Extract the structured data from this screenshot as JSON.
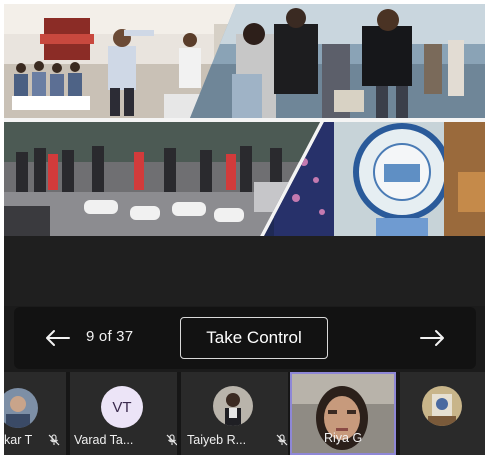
{
  "presentation": {
    "slide_current": "9",
    "slide_total": "37",
    "counter_text": "9 of 37",
    "take_control_label": "Take Control",
    "prev_icon": "arrow-left-icon",
    "next_icon": "arrow-right-icon"
  },
  "participants": [
    {
      "name": "kar T",
      "muted": true,
      "avatar": "photo"
    },
    {
      "name": "Varad Ta...",
      "initials": "VT",
      "muted": true,
      "avatar": "initials"
    },
    {
      "name": "Taiyeb R...",
      "muted": true,
      "avatar": "photo"
    },
    {
      "name": "Riya G",
      "muted": false,
      "avatar": "video",
      "active_speaker": true
    },
    {
      "name": "",
      "muted": false,
      "avatar": "photo"
    }
  ],
  "colors": {
    "stage_bg": "#1f1f1f",
    "control_bar_bg": "#121212",
    "active_border": "#8e87d6",
    "initials_avatar_bg": "#ece4f7"
  }
}
